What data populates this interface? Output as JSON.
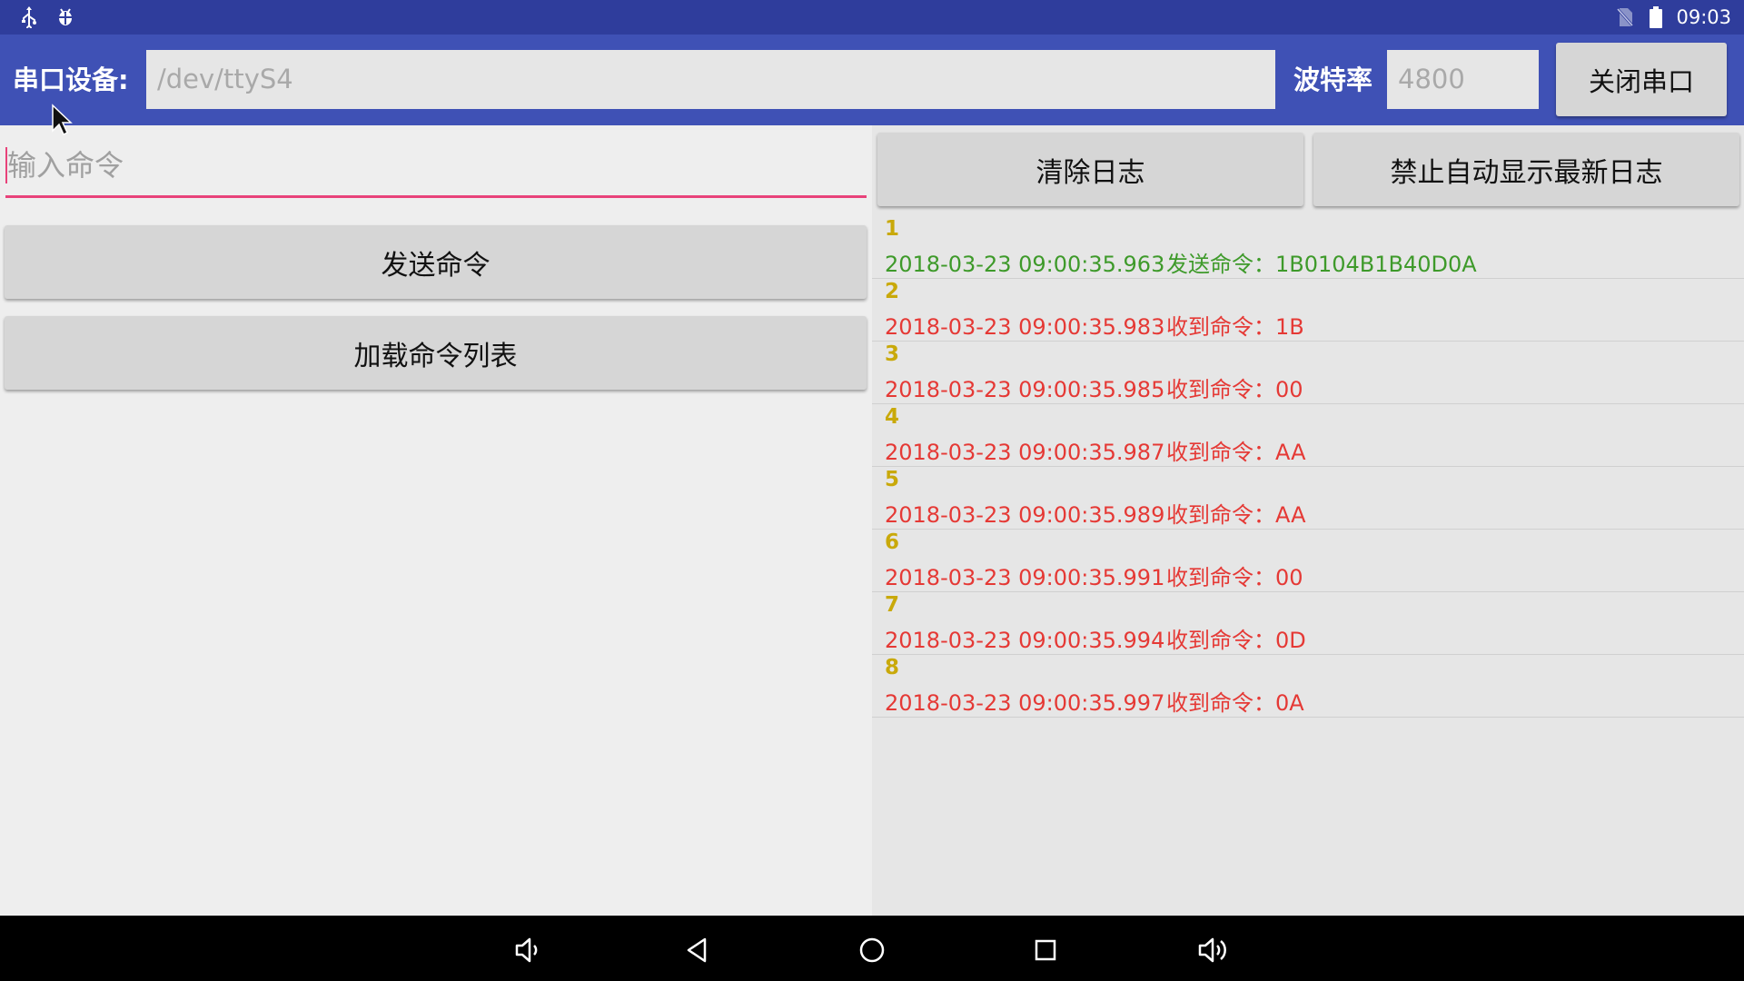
{
  "status_bar": {
    "time": "09:03",
    "left_icons": [
      "usb-icon",
      "android-debug-icon"
    ],
    "right_icons": [
      "no-sim-icon",
      "battery-icon"
    ]
  },
  "toolbar": {
    "device_label": "串口设备:",
    "device_placeholder": "/dev/ttyS4",
    "baud_label": "波特率",
    "baud_placeholder": "4800",
    "close_button": "关闭串口"
  },
  "left_pane": {
    "command_placeholder": "输入命令",
    "send_button": "发送命令",
    "load_button": "加载命令列表"
  },
  "right_pane": {
    "clear_button": "清除日志",
    "autoscroll_button": "禁止自动显示最新日志",
    "logs": [
      {
        "num": "1",
        "time": "2018-03-23 09:00:35.963",
        "text": "发送命令：1B0104B1B40D0A",
        "type": "sent"
      },
      {
        "num": "2",
        "time": "2018-03-23 09:00:35.983",
        "text": "收到命令：1B",
        "type": "recv"
      },
      {
        "num": "3",
        "time": "2018-03-23 09:00:35.985",
        "text": "收到命令：00",
        "type": "recv"
      },
      {
        "num": "4",
        "time": "2018-03-23 09:00:35.987",
        "text": "收到命令：AA",
        "type": "recv"
      },
      {
        "num": "5",
        "time": "2018-03-23 09:00:35.989",
        "text": "收到命令：AA",
        "type": "recv"
      },
      {
        "num": "6",
        "time": "2018-03-23 09:00:35.991",
        "text": "收到命令：00",
        "type": "recv"
      },
      {
        "num": "7",
        "time": "2018-03-23 09:00:35.994",
        "text": "收到命令：0D",
        "type": "recv"
      },
      {
        "num": "8",
        "time": "2018-03-23 09:00:35.997",
        "text": "收到命令：0A",
        "type": "recv"
      }
    ]
  },
  "nav_bar": {
    "icons": [
      "volume-down-icon",
      "back-icon",
      "home-icon",
      "recents-icon",
      "volume-up-icon"
    ]
  },
  "colors": {
    "status_bar": "#2f3d9c",
    "toolbar": "#3f51b5",
    "sent": "#3e9a2a",
    "recv": "#e53935",
    "log_number": "#c9a90a",
    "accent": "#e8427a"
  }
}
